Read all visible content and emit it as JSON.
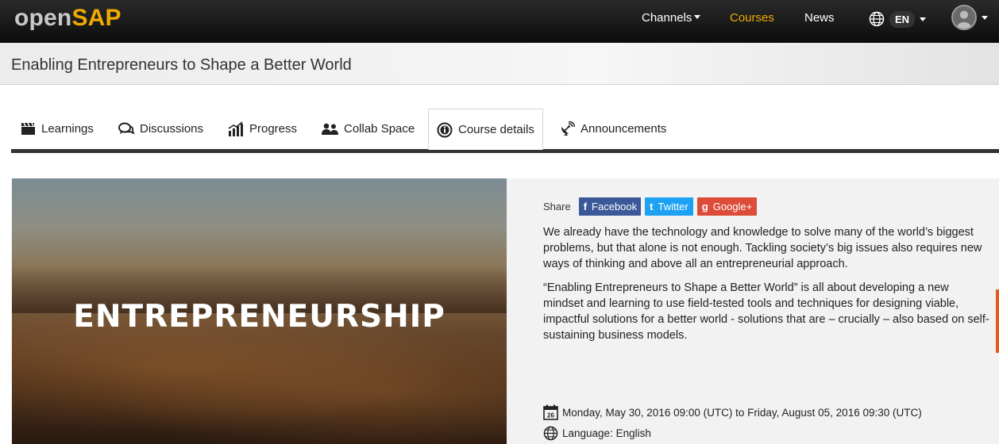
{
  "brand": {
    "open": "open",
    "sap": "SAP"
  },
  "nav": {
    "channels": "Channels",
    "courses": "Courses",
    "news": "News",
    "language": "EN"
  },
  "colors": {
    "accent": "#f0ab00",
    "facebook": "#3b5998",
    "twitter": "#1da1f2",
    "googleplus": "#dd4b39"
  },
  "page": {
    "title": "Enabling Entrepreneurs to Shape a Better World"
  },
  "tabs": [
    {
      "label": "Learnings",
      "icon": "clapperboard-icon"
    },
    {
      "label": "Discussions",
      "icon": "chat-bubbles-icon"
    },
    {
      "label": "Progress",
      "icon": "bar-chart-icon"
    },
    {
      "label": "Collab Space",
      "icon": "users-icon"
    },
    {
      "label": "Course details",
      "icon": "info-icon",
      "active": true
    },
    {
      "label": "Announcements",
      "icon": "satellite-dish-icon"
    }
  ],
  "hero": {
    "text": "ENTREPRENEURSHIP"
  },
  "share": {
    "label": "Share",
    "facebook": "Facebook",
    "twitter": "Twitter",
    "googleplus": "Google+"
  },
  "description": {
    "p1": "We already have the technology and knowledge to solve many of the world’s biggest problems, but that alone is not enough. Tackling society’s big issues also requires new ways of thinking and above all an entrepreneurial approach.",
    "p2": "“Enabling Entrepreneurs to Shape a Better World” is all about developing a new mindset and learning to use field-tested tools and techniques for designing viable, impactful solutions for a better world - solutions that are – crucially – also based on self-sustaining business models."
  },
  "meta": {
    "calendar_day": "26",
    "dates": "Monday, May 30, 2016 09:00 (UTC) to Friday, August 05, 2016 09:30 (UTC)",
    "language": "Language: English"
  }
}
